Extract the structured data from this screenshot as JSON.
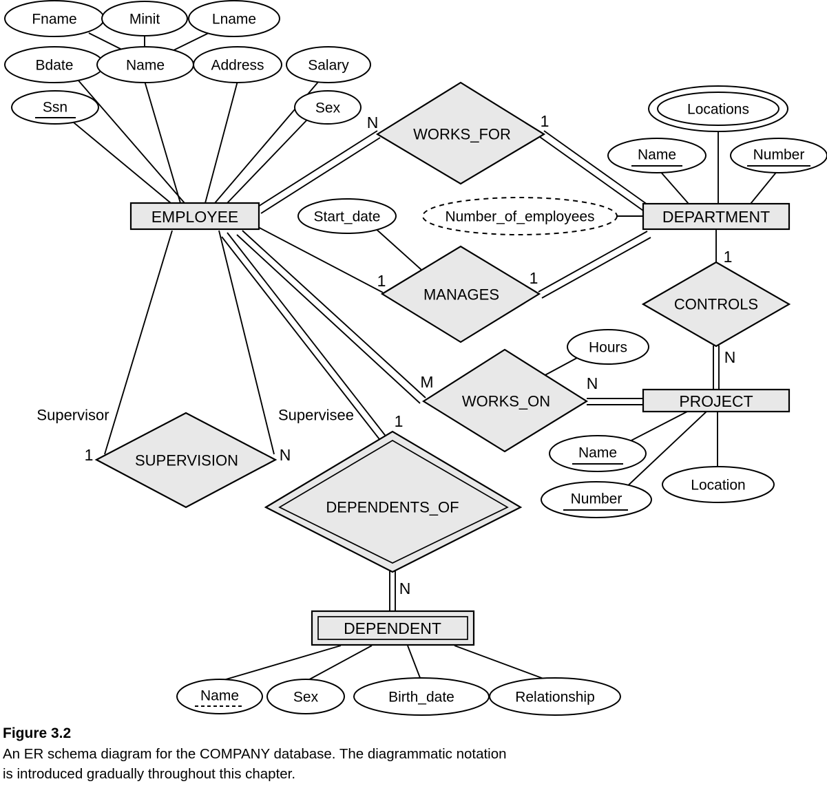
{
  "figure": {
    "number": "Figure 3.2",
    "caption_line1": "An ER schema diagram for the COMPANY database. The diagrammatic notation",
    "caption_line2": "is introduced gradually throughout this chapter."
  },
  "colors": {
    "shape_fill": "#e8e8e8",
    "stroke": "#000000",
    "background": "#ffffff",
    "ellipse_fill": "#ffffff"
  },
  "entities": {
    "employee": {
      "label": "EMPLOYEE",
      "type": "strong"
    },
    "department": {
      "label": "DEPARTMENT",
      "type": "strong"
    },
    "project": {
      "label": "PROJECT",
      "type": "strong"
    },
    "dependent": {
      "label": "DEPENDENT",
      "type": "weak"
    }
  },
  "relationships": {
    "works_for": {
      "label": "WORKS_FOR",
      "type": "normal"
    },
    "manages": {
      "label": "MANAGES",
      "type": "normal"
    },
    "controls": {
      "label": "CONTROLS",
      "type": "normal"
    },
    "works_on": {
      "label": "WORKS_ON",
      "type": "normal"
    },
    "supervision": {
      "label": "SUPERVISION",
      "type": "normal"
    },
    "dependents_of": {
      "label": "DEPENDENTS_OF",
      "type": "identifying"
    }
  },
  "attributes": {
    "fname": {
      "label": "Fname",
      "kind": "simple"
    },
    "minit": {
      "label": "Minit",
      "kind": "simple"
    },
    "lname": {
      "label": "Lname",
      "kind": "simple"
    },
    "bdate": {
      "label": "Bdate",
      "kind": "simple"
    },
    "emp_name": {
      "label": "Name",
      "kind": "composite"
    },
    "address": {
      "label": "Address",
      "kind": "simple"
    },
    "salary": {
      "label": "Salary",
      "kind": "simple"
    },
    "ssn": {
      "label": "Ssn",
      "kind": "key"
    },
    "sex": {
      "label": "Sex",
      "kind": "simple"
    },
    "start_date": {
      "label": "Start_date",
      "kind": "simple"
    },
    "number_of_employees": {
      "label": "Number_of_employees",
      "kind": "derived"
    },
    "dept_locations": {
      "label": "Locations",
      "kind": "multivalued"
    },
    "dept_name": {
      "label": "Name",
      "kind": "key"
    },
    "dept_number": {
      "label": "Number",
      "kind": "key"
    },
    "hours": {
      "label": "Hours",
      "kind": "simple"
    },
    "proj_name": {
      "label": "Name",
      "kind": "key"
    },
    "proj_number": {
      "label": "Number",
      "kind": "key"
    },
    "proj_location": {
      "label": "Location",
      "kind": "simple"
    },
    "dep_name": {
      "label": "Name",
      "kind": "partial-key"
    },
    "dep_sex": {
      "label": "Sex",
      "kind": "simple"
    },
    "dep_birth_date": {
      "label": "Birth_date",
      "kind": "simple"
    },
    "dep_relationship": {
      "label": "Relationship",
      "kind": "simple"
    }
  },
  "cardinalities": {
    "works_for_employee": "N",
    "works_for_department": "1",
    "manages_employee": "1",
    "manages_department": "1",
    "controls_department": "1",
    "controls_project": "N",
    "works_on_employee": "M",
    "works_on_project": "N",
    "supervision_supervisor": "1",
    "supervision_supervisee": "N",
    "dependents_of_employee": "1",
    "dependents_of_dependent": "N"
  },
  "roles": {
    "supervisor": "Supervisor",
    "supervisee": "Supervisee"
  }
}
